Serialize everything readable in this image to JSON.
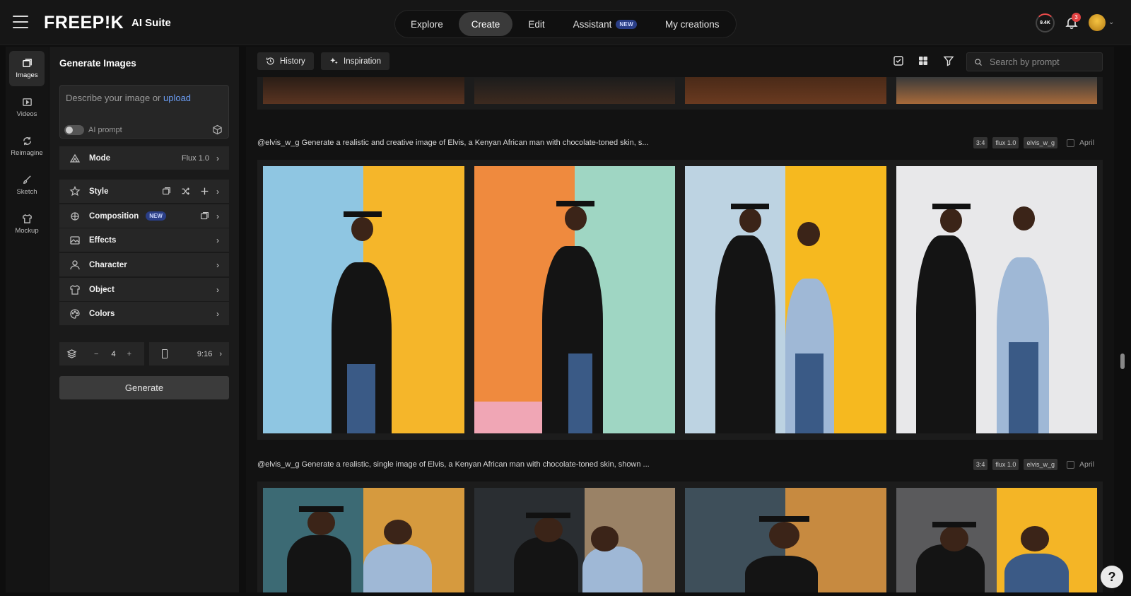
{
  "brand": {
    "logo": "FREEP!K",
    "suite": "AI Suite"
  },
  "nav": {
    "tabs": [
      {
        "label": "Explore"
      },
      {
        "label": "Create"
      },
      {
        "label": "Edit"
      },
      {
        "label": "Assistant",
        "badge": "NEW"
      },
      {
        "label": "My creations"
      }
    ],
    "active": "Create"
  },
  "header": {
    "credits": "9.4K",
    "notifications": "3"
  },
  "rail": {
    "items": [
      {
        "label": "Images",
        "icon": "images-icon"
      },
      {
        "label": "Videos",
        "icon": "video-icon"
      },
      {
        "label": "Reimagine",
        "icon": "reimagine-icon"
      },
      {
        "label": "Sketch",
        "icon": "brush-icon"
      },
      {
        "label": "Mockup",
        "icon": "mockup-icon"
      }
    ]
  },
  "panel": {
    "title": "Generate Images",
    "prompt_placeholder": "Describe your image or ",
    "prompt_link": "upload",
    "ai_prompt_label": "AI prompt",
    "mode": {
      "label": "Mode",
      "value": "Flux 1.0"
    },
    "style_label": "Style",
    "composition": {
      "label": "Composition",
      "badge": "NEW"
    },
    "effects_label": "Effects",
    "character_label": "Character",
    "object_label": "Object",
    "colors_label": "Colors",
    "count": {
      "minus": "−",
      "value": "4",
      "plus": "+"
    },
    "ratio": "9:16",
    "generate_label": "Generate"
  },
  "toolbar": {
    "history": "History",
    "inspiration": "Inspiration",
    "search_placeholder": "Search by prompt"
  },
  "groups": [
    {
      "prompt": "@elvis_w_g Generate a realistic and creative image of Elvis, a Kenyan African man with chocolate-toned skin, s...",
      "tags": [
        "3:4",
        "flux 1.0",
        "elvis_w_g"
      ],
      "date": "April"
    },
    {
      "prompt": "@elvis_w_g Generate a realistic, single image of Elvis, a Kenyan African man with chocolate-toned skin, shown ...",
      "tags": [
        "3:4",
        "flux 1.0",
        "elvis_w_g"
      ],
      "date": "April"
    }
  ],
  "help": "?",
  "colors": {
    "accent_link": "#6a9cf3",
    "badge_bg": "#2a3e86",
    "notification": "#e34242"
  }
}
